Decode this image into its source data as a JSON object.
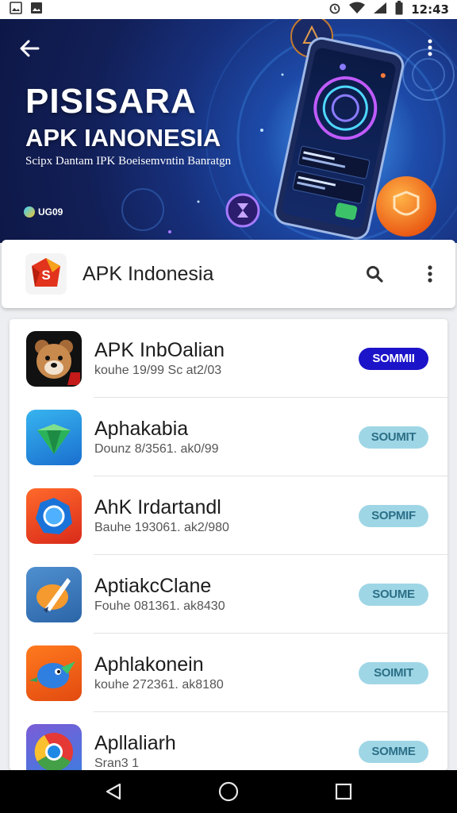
{
  "status_bar": {
    "time": "12:43",
    "left_icons": [
      "image-icon",
      "photo-icon"
    ],
    "right_icons": [
      "alarm-icon",
      "wifi-icon",
      "signal-icon",
      "battery-icon"
    ]
  },
  "banner": {
    "title": "PISISARA",
    "subtitle": "APK IANONESIA",
    "tagline": "Scipx Dantam IPK Boeisemvntin Banratgn",
    "badge": "UG09",
    "back_icon": "arrow-left-icon",
    "menu_icon": "more-vertical-icon"
  },
  "header": {
    "logo_letter": "S",
    "title": "APK Indonesia",
    "search_icon": "search-icon",
    "menu_icon": "more-vertical-icon"
  },
  "apps": [
    {
      "name": "APK InbOalian",
      "meta": "kouhe 19/99 Sc at2/03",
      "button": "SOMMII",
      "style": "primary",
      "icon": "bear-icon"
    },
    {
      "name": "Aphakabia",
      "meta": "Dounz 8/3561. ak0/99",
      "button": "SOUMIT",
      "style": "secondary",
      "icon": "diamond-icon"
    },
    {
      "name": "AhK Irdartandl",
      "meta": "Bauhe 193061. ak2/980",
      "button": "SOPMIF",
      "style": "secondary",
      "icon": "frame-icon"
    },
    {
      "name": "AptiakcClane",
      "meta": "Fouhe 081361. ak8430",
      "button": "SOUME",
      "style": "secondary",
      "icon": "brush-icon"
    },
    {
      "name": "Aphlakonein",
      "meta": "kouhe 272361. ak8180",
      "button": "SOIMIT",
      "style": "secondary",
      "icon": "bird-icon"
    },
    {
      "name": "Apllaliarh",
      "meta": "Sran3 1",
      "button": "SOMME",
      "style": "secondary",
      "icon": "chrome-icon"
    }
  ],
  "nav": {
    "back": "nav-back-icon",
    "home": "nav-home-icon",
    "recents": "nav-recents-icon"
  },
  "colors": {
    "primary_button": "#1c14c8",
    "secondary_button": "#9fd6e6",
    "secondary_button_text": "#2b6f86",
    "banner_dark": "#0e1847",
    "banner_glow": "#2f79d8"
  }
}
